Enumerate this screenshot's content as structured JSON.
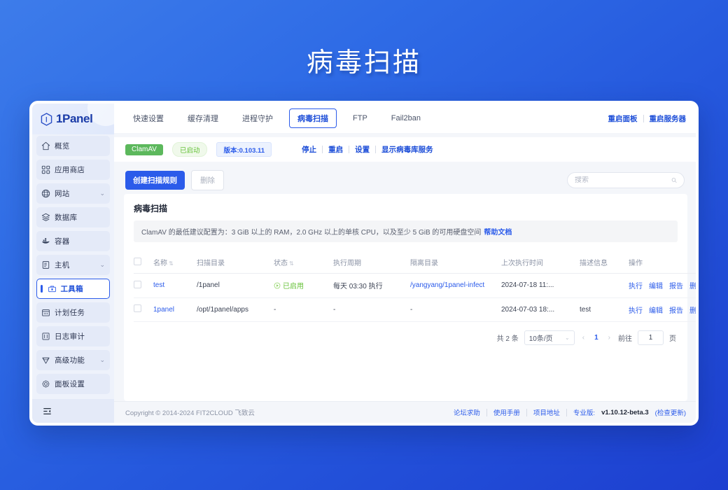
{
  "page": {
    "title": "病毒扫描"
  },
  "sidebar": {
    "logo_text": "1Panel",
    "items": [
      {
        "label": "概览",
        "icon": "home-icon",
        "chevron": ""
      },
      {
        "label": "应用商店",
        "icon": "apps-icon",
        "chevron": ""
      },
      {
        "label": "网站",
        "icon": "globe-icon",
        "chevron": "⌄"
      },
      {
        "label": "数据库",
        "icon": "database-icon",
        "chevron": ""
      },
      {
        "label": "容器",
        "icon": "container-icon",
        "chevron": ""
      },
      {
        "label": "主机",
        "icon": "server-icon",
        "chevron": "⌄"
      },
      {
        "label": "工具箱",
        "icon": "toolbox-icon",
        "chevron": ""
      },
      {
        "label": "计划任务",
        "icon": "calendar-icon",
        "chevron": ""
      },
      {
        "label": "日志审计",
        "icon": "log-icon",
        "chevron": ""
      },
      {
        "label": "高级功能",
        "icon": "diamond-icon",
        "chevron": "⌄"
      },
      {
        "label": "面板设置",
        "icon": "gear-icon",
        "chevron": ""
      }
    ],
    "active_index": 6,
    "collapse_icon": "collapse-sidebar-icon"
  },
  "tabs": [
    {
      "label": "快速设置",
      "active": false
    },
    {
      "label": "缓存清理",
      "active": false
    },
    {
      "label": "进程守护",
      "active": false
    },
    {
      "label": "病毒扫描",
      "active": true
    },
    {
      "label": "FTP",
      "active": false
    },
    {
      "label": "Fail2ban",
      "active": false
    }
  ],
  "top_links": {
    "restart_panel": "重启面板",
    "restart_server": "重启服务器"
  },
  "status": {
    "service_name": "ClamAV",
    "running_label": "已启动",
    "version_label": "版本:0.103.11",
    "actions": [
      "停止",
      "重启",
      "设置",
      "显示病毒库服务"
    ]
  },
  "toolbar": {
    "create_label": "创建扫描规则",
    "delete_label": "删除",
    "search_placeholder": "搜索",
    "search_value": "",
    "search_icon": "search-icon"
  },
  "card": {
    "title": "病毒扫描",
    "notice": "ClamAV 的最低建议配置为：3 GiB 以上的 RAM，2.0 GHz 以上的单核 CPU，以及至少 5 GiB 的可用硬盘空间",
    "notice_link": "帮助文档"
  },
  "table": {
    "columns": [
      {
        "label": "名称",
        "sortable": true
      },
      {
        "label": "扫描目录",
        "sortable": false
      },
      {
        "label": "状态",
        "sortable": true
      },
      {
        "label": "执行周期",
        "sortable": false
      },
      {
        "label": "隔离目录",
        "sortable": false
      },
      {
        "label": "上次执行时间",
        "sortable": false
      },
      {
        "label": "描述信息",
        "sortable": false
      },
      {
        "label": "操作",
        "sortable": false
      }
    ],
    "rows": [
      {
        "name": "test",
        "scan_dir": "/1panel",
        "status": "已启用",
        "status_enabled": true,
        "cycle": "每天 03:30 执行",
        "quarantine_dir": "/yangyang/1panel-infect",
        "last_run": "2024-07-18 11:...",
        "description": "",
        "ops": [
          "执行",
          "编辑",
          "报告",
          "删除"
        ]
      },
      {
        "name": "1panel",
        "scan_dir": "/opt/1panel/apps",
        "status": "-",
        "status_enabled": false,
        "cycle": "-",
        "quarantine_dir": "-",
        "last_run": "2024-07-03 18:...",
        "description": "test",
        "ops": [
          "执行",
          "编辑",
          "报告",
          "删除"
        ]
      }
    ]
  },
  "pagination": {
    "total_label": "共 2 条",
    "page_size": "10条/页",
    "prev": "‹",
    "current_page": "1",
    "next": "›",
    "goto_label": "前往",
    "goto_value": "1",
    "page_unit": "页"
  },
  "footer": {
    "copyright": "Copyright © 2014-2024 FIT2CLOUD 飞致云",
    "links": [
      "论坛求助",
      "使用手册",
      "项目地址"
    ],
    "edition_label": "专业版:",
    "version": "v1.10.12-beta.3",
    "update_label": "(检查更新)"
  },
  "colors": {
    "brand_blue": "#2b5bea",
    "bg_gradient_start": "#3d7cea",
    "bg_gradient_end": "#1d3fd0",
    "success_green": "#67c23a",
    "clamav_green": "#5cb85c"
  }
}
